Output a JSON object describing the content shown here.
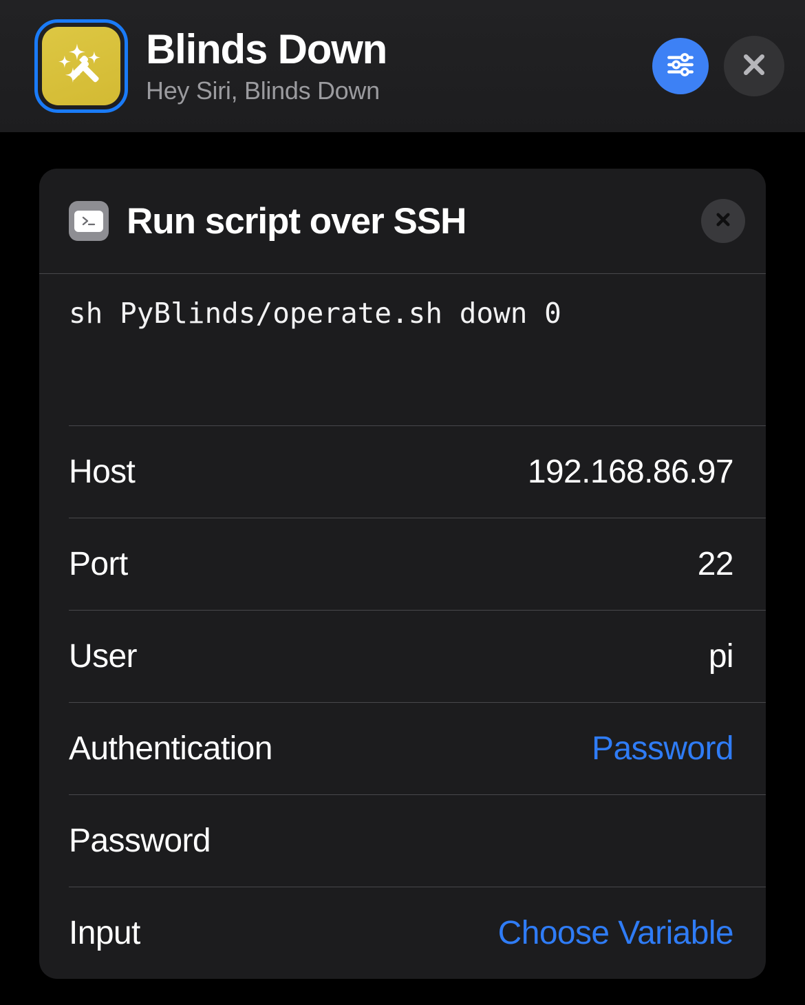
{
  "header": {
    "icon_name": "magic-wand-icon",
    "icon_bg_color": "#d9c23f",
    "selection_ring_color": "#1a7bf7",
    "title": "Blinds Down",
    "subtitle": "Hey Siri, Blinds Down",
    "settings_button": {
      "icon_name": "sliders-icon",
      "color": "#3d81f5"
    },
    "close_button": {
      "icon_name": "close-icon",
      "color": "#333335"
    }
  },
  "card": {
    "icon_name": "terminal-icon",
    "title": "Run script over SSH",
    "close_button_icon": "close-icon",
    "script": "sh PyBlinds/operate.sh down 0",
    "fields": [
      {
        "label": "Host",
        "value": "192.168.86.97",
        "style": "plain"
      },
      {
        "label": "Port",
        "value": "22",
        "style": "plain"
      },
      {
        "label": "User",
        "value": "pi",
        "style": "plain"
      },
      {
        "label": "Authentication",
        "value": "Password",
        "style": "accent"
      },
      {
        "label": "Password",
        "value": "",
        "style": "empty"
      },
      {
        "label": "Input",
        "value": "Choose Variable",
        "style": "accent"
      }
    ]
  },
  "colors": {
    "page_background": "#000000",
    "header_background": "#1f1f21",
    "card_background": "#1c1c1e",
    "accent_blue": "#2f7cf6",
    "divider": "#48484c"
  }
}
